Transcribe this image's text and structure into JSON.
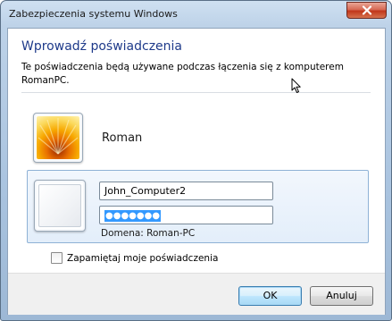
{
  "window": {
    "title": "Zabezpieczenia systemu Windows"
  },
  "dialog": {
    "heading": "Wprowadź poświadczenia",
    "description": "Te poświadczenia będą używane podczas łączenia się z komputerem RomanPC."
  },
  "saved_user": {
    "name": "Roman"
  },
  "credentials": {
    "username_value": "John_Computer2",
    "password_masked": "●●●●●●●",
    "domain_text": "Domena: Roman-PC"
  },
  "remember": {
    "label": "Zapamiętaj moje poświadczenia",
    "checked": false
  },
  "buttons": {
    "ok_label": "OK",
    "cancel_label": "Anuluj"
  },
  "icons": {
    "close": "close-icon",
    "user_picture": "flower-avatar",
    "blank_user": "blank-avatar",
    "cursor": "mouse-pointer-icon"
  },
  "colors": {
    "heading": "#1e3a8a",
    "close_button": "#c1361a",
    "selection": "#3399ff",
    "panel_border": "#8fb2d6"
  }
}
